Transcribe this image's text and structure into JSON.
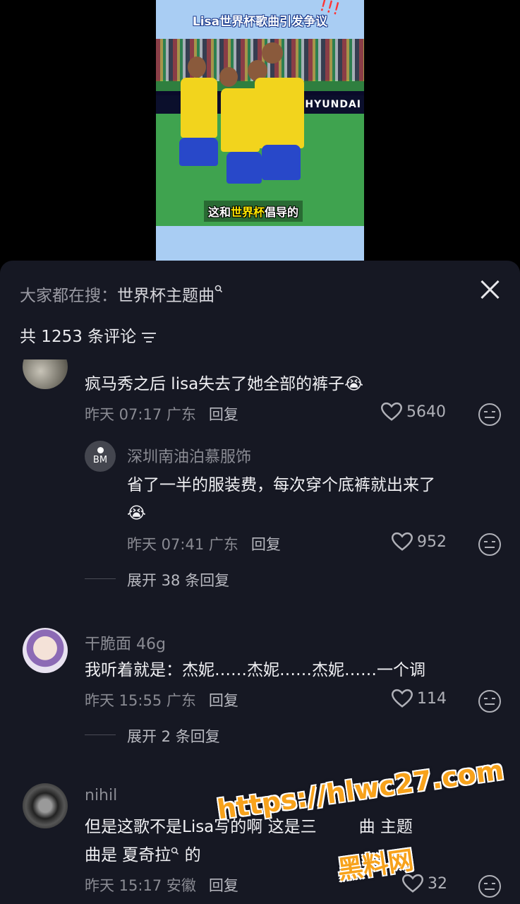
{
  "video": {
    "title": "Lisa世界杯歌曲引发争议",
    "title_marks": "!!!",
    "board_text": "HYUNDAI",
    "caption_pre": "这和",
    "caption_hl": "世界杯",
    "caption_post": "倡导的"
  },
  "sheet": {
    "search_prefix": "大家都在搜：",
    "search_term": "世界杯主题曲",
    "search_icon": "search-icon",
    "comment_count": "共 1253 条评论",
    "colors": {
      "background": "#161823",
      "accent": "#f7a21b"
    }
  },
  "comments": [
    {
      "text": "疯马秀之后 lisa失去了她全部的裤子😭",
      "time": "昨天 07:17 广东",
      "reply": "回复",
      "likes": "5640"
    },
    {
      "avatar_text": "BM",
      "name": "深圳南油泊慕服饰",
      "text_line1": "省了一半的服装费，每次穿个底裤就出来了",
      "text_line2": "😭",
      "time": "昨天 07:41 广东",
      "reply": "回复",
      "likes": "952"
    },
    {
      "expand": "展开 38 条回复"
    },
    {
      "name": "干脆面 46g",
      "text": "我听着就是：杰妮……杰妮……杰妮……一个调",
      "time": "昨天 15:55 广东",
      "reply": "回复",
      "likes": "114",
      "expand": "展开 2 条回复"
    },
    {
      "name": "nihil",
      "text_line1": "但是这歌不是Lisa写的啊 这是三",
      "text_line1_tail": "曲 主题",
      "text_line2": "曲是 夏奇拉",
      "text_line2_tail": " 的",
      "time": "昨天 15:17 安徽",
      "reply": "回复",
      "likes": "32"
    }
  ],
  "watermark": {
    "url": "https://hlwc27.com",
    "name": "黑料网"
  }
}
